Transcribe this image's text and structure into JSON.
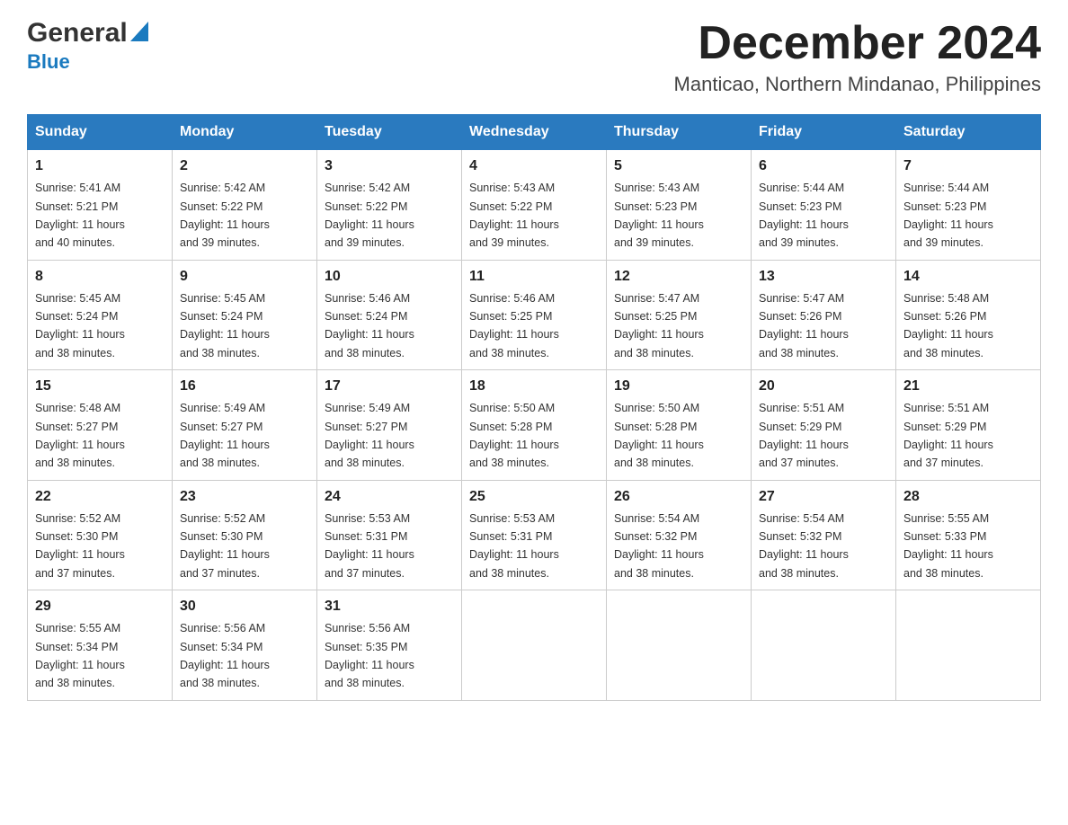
{
  "header": {
    "logo_general": "General",
    "logo_blue": "Blue",
    "month_title": "December 2024",
    "location": "Manticao, Northern Mindanao, Philippines"
  },
  "weekdays": [
    "Sunday",
    "Monday",
    "Tuesday",
    "Wednesday",
    "Thursday",
    "Friday",
    "Saturday"
  ],
  "weeks": [
    [
      {
        "day": "1",
        "sunrise": "5:41 AM",
        "sunset": "5:21 PM",
        "daylight": "11 hours and 40 minutes."
      },
      {
        "day": "2",
        "sunrise": "5:42 AM",
        "sunset": "5:22 PM",
        "daylight": "11 hours and 39 minutes."
      },
      {
        "day": "3",
        "sunrise": "5:42 AM",
        "sunset": "5:22 PM",
        "daylight": "11 hours and 39 minutes."
      },
      {
        "day": "4",
        "sunrise": "5:43 AM",
        "sunset": "5:22 PM",
        "daylight": "11 hours and 39 minutes."
      },
      {
        "day": "5",
        "sunrise": "5:43 AM",
        "sunset": "5:23 PM",
        "daylight": "11 hours and 39 minutes."
      },
      {
        "day": "6",
        "sunrise": "5:44 AM",
        "sunset": "5:23 PM",
        "daylight": "11 hours and 39 minutes."
      },
      {
        "day": "7",
        "sunrise": "5:44 AM",
        "sunset": "5:23 PM",
        "daylight": "11 hours and 39 minutes."
      }
    ],
    [
      {
        "day": "8",
        "sunrise": "5:45 AM",
        "sunset": "5:24 PM",
        "daylight": "11 hours and 38 minutes."
      },
      {
        "day": "9",
        "sunrise": "5:45 AM",
        "sunset": "5:24 PM",
        "daylight": "11 hours and 38 minutes."
      },
      {
        "day": "10",
        "sunrise": "5:46 AM",
        "sunset": "5:24 PM",
        "daylight": "11 hours and 38 minutes."
      },
      {
        "day": "11",
        "sunrise": "5:46 AM",
        "sunset": "5:25 PM",
        "daylight": "11 hours and 38 minutes."
      },
      {
        "day": "12",
        "sunrise": "5:47 AM",
        "sunset": "5:25 PM",
        "daylight": "11 hours and 38 minutes."
      },
      {
        "day": "13",
        "sunrise": "5:47 AM",
        "sunset": "5:26 PM",
        "daylight": "11 hours and 38 minutes."
      },
      {
        "day": "14",
        "sunrise": "5:48 AM",
        "sunset": "5:26 PM",
        "daylight": "11 hours and 38 minutes."
      }
    ],
    [
      {
        "day": "15",
        "sunrise": "5:48 AM",
        "sunset": "5:27 PM",
        "daylight": "11 hours and 38 minutes."
      },
      {
        "day": "16",
        "sunrise": "5:49 AM",
        "sunset": "5:27 PM",
        "daylight": "11 hours and 38 minutes."
      },
      {
        "day": "17",
        "sunrise": "5:49 AM",
        "sunset": "5:27 PM",
        "daylight": "11 hours and 38 minutes."
      },
      {
        "day": "18",
        "sunrise": "5:50 AM",
        "sunset": "5:28 PM",
        "daylight": "11 hours and 38 minutes."
      },
      {
        "day": "19",
        "sunrise": "5:50 AM",
        "sunset": "5:28 PM",
        "daylight": "11 hours and 38 minutes."
      },
      {
        "day": "20",
        "sunrise": "5:51 AM",
        "sunset": "5:29 PM",
        "daylight": "11 hours and 37 minutes."
      },
      {
        "day": "21",
        "sunrise": "5:51 AM",
        "sunset": "5:29 PM",
        "daylight": "11 hours and 37 minutes."
      }
    ],
    [
      {
        "day": "22",
        "sunrise": "5:52 AM",
        "sunset": "5:30 PM",
        "daylight": "11 hours and 37 minutes."
      },
      {
        "day": "23",
        "sunrise": "5:52 AM",
        "sunset": "5:30 PM",
        "daylight": "11 hours and 37 minutes."
      },
      {
        "day": "24",
        "sunrise": "5:53 AM",
        "sunset": "5:31 PM",
        "daylight": "11 hours and 37 minutes."
      },
      {
        "day": "25",
        "sunrise": "5:53 AM",
        "sunset": "5:31 PM",
        "daylight": "11 hours and 38 minutes."
      },
      {
        "day": "26",
        "sunrise": "5:54 AM",
        "sunset": "5:32 PM",
        "daylight": "11 hours and 38 minutes."
      },
      {
        "day": "27",
        "sunrise": "5:54 AM",
        "sunset": "5:32 PM",
        "daylight": "11 hours and 38 minutes."
      },
      {
        "day": "28",
        "sunrise": "5:55 AM",
        "sunset": "5:33 PM",
        "daylight": "11 hours and 38 minutes."
      }
    ],
    [
      {
        "day": "29",
        "sunrise": "5:55 AM",
        "sunset": "5:34 PM",
        "daylight": "11 hours and 38 minutes."
      },
      {
        "day": "30",
        "sunrise": "5:56 AM",
        "sunset": "5:34 PM",
        "daylight": "11 hours and 38 minutes."
      },
      {
        "day": "31",
        "sunrise": "5:56 AM",
        "sunset": "5:35 PM",
        "daylight": "11 hours and 38 minutes."
      },
      null,
      null,
      null,
      null
    ]
  ],
  "labels": {
    "sunrise": "Sunrise:",
    "sunset": "Sunset:",
    "daylight": "Daylight:"
  }
}
